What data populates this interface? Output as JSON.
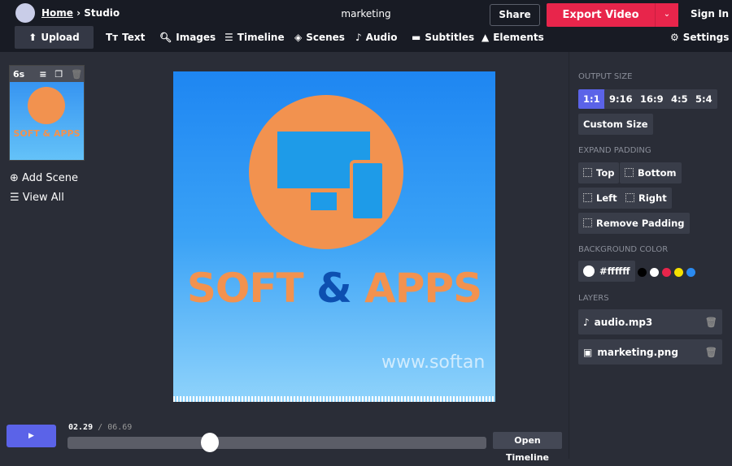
{
  "header": {
    "breadcrumb_home": "Home",
    "breadcrumb_sep": "›",
    "breadcrumb_current": "Studio",
    "project_title": "marketing",
    "share_label": "Share",
    "export_label": "Export Video",
    "signin_label": "Sign In"
  },
  "nav": {
    "upload": "Upload",
    "text": "Text",
    "images": "Images",
    "timeline": "Timeline",
    "scenes": "Scenes",
    "audio": "Audio",
    "subtitles": "Subtitles",
    "elements": "Elements",
    "settings": "Settings"
  },
  "scenes": {
    "duration": "6s",
    "add_scene": "Add Scene",
    "view_all": "View All"
  },
  "canvas": {
    "logo_text": "SOFT & APPS",
    "watermark": "www.softan"
  },
  "panel": {
    "output_size_label": "OUTPUT SIZE",
    "sizes": [
      "1:1",
      "9:16",
      "16:9",
      "4:5",
      "5:4"
    ],
    "selected_size": "1:1",
    "custom_size": "Custom Size",
    "expand_padding_label": "EXPAND PADDING",
    "padding": {
      "top": "Top",
      "bottom": "Bottom",
      "left": "Left",
      "right": "Right",
      "remove": "Remove Padding"
    },
    "background_color_label": "BACKGROUND COLOR",
    "background_color": "#ffffff",
    "swatches": [
      "#000000",
      "#ffffff",
      "#e8254b",
      "#f5e000",
      "#2a8af0"
    ],
    "layers_label": "LAYERS",
    "layers": [
      {
        "name": "audio.mp3",
        "icon": "music-note-icon"
      },
      {
        "name": "marketing.png",
        "icon": "image-icon"
      }
    ]
  },
  "player": {
    "current_time": "02.29",
    "separator": "/",
    "total_time": "06.69",
    "progress_percent": 34,
    "open_timeline": "Open Timeline"
  },
  "colors": {
    "accent": "#5b63e8",
    "export": "#e8254b",
    "logo_orange": "#f2924f"
  }
}
